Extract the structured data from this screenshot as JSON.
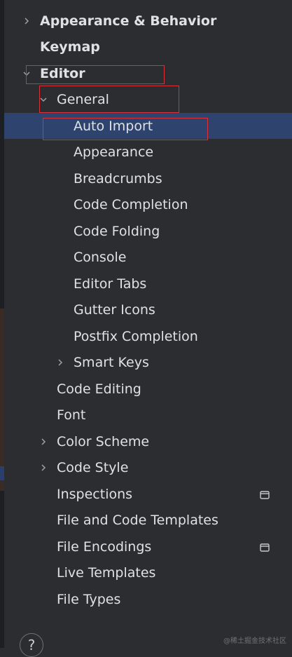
{
  "tree": [
    {
      "label": "Appearance & Behavior",
      "level": 0,
      "bold": true,
      "expander": "collapsed"
    },
    {
      "label": "Keymap",
      "level": 0,
      "bold": true,
      "expander": "none"
    },
    {
      "label": "Editor",
      "level": 0,
      "bold": true,
      "expander": "expanded"
    },
    {
      "label": "General",
      "level": 1,
      "bold": false,
      "expander": "expanded"
    },
    {
      "label": "Auto Import",
      "level": 2,
      "bold": false,
      "expander": "none",
      "selected": true
    },
    {
      "label": "Appearance",
      "level": 2,
      "bold": false,
      "expander": "none"
    },
    {
      "label": "Breadcrumbs",
      "level": 2,
      "bold": false,
      "expander": "none"
    },
    {
      "label": "Code Completion",
      "level": 2,
      "bold": false,
      "expander": "none"
    },
    {
      "label": "Code Folding",
      "level": 2,
      "bold": false,
      "expander": "none"
    },
    {
      "label": "Console",
      "level": 2,
      "bold": false,
      "expander": "none"
    },
    {
      "label": "Editor Tabs",
      "level": 2,
      "bold": false,
      "expander": "none"
    },
    {
      "label": "Gutter Icons",
      "level": 2,
      "bold": false,
      "expander": "none"
    },
    {
      "label": "Postfix Completion",
      "level": 2,
      "bold": false,
      "expander": "none"
    },
    {
      "label": "Smart Keys",
      "level": 2,
      "bold": false,
      "expander": "collapsed"
    },
    {
      "label": "Code Editing",
      "level": 1,
      "bold": false,
      "expander": "none"
    },
    {
      "label": "Font",
      "level": 1,
      "bold": false,
      "expander": "none"
    },
    {
      "label": "Color Scheme",
      "level": 1,
      "bold": false,
      "expander": "collapsed"
    },
    {
      "label": "Code Style",
      "level": 1,
      "bold": false,
      "expander": "collapsed"
    },
    {
      "label": "Inspections",
      "level": 1,
      "bold": false,
      "expander": "none",
      "scope_icon": true
    },
    {
      "label": "File and Code Templates",
      "level": 1,
      "bold": false,
      "expander": "none"
    },
    {
      "label": "File Encodings",
      "level": 1,
      "bold": false,
      "expander": "none",
      "scope_icon": true
    },
    {
      "label": "Live Templates",
      "level": 1,
      "bold": false,
      "expander": "none"
    },
    {
      "label": "File Types",
      "level": 1,
      "bold": false,
      "expander": "none"
    }
  ],
  "help_button": {
    "glyph": "?"
  },
  "watermark": "@稀土掘金技术社区",
  "colors": {
    "background": "#2b2d30",
    "selection": "#2e436e",
    "text": "#dfe1e5",
    "annotation": "#d9303a"
  }
}
